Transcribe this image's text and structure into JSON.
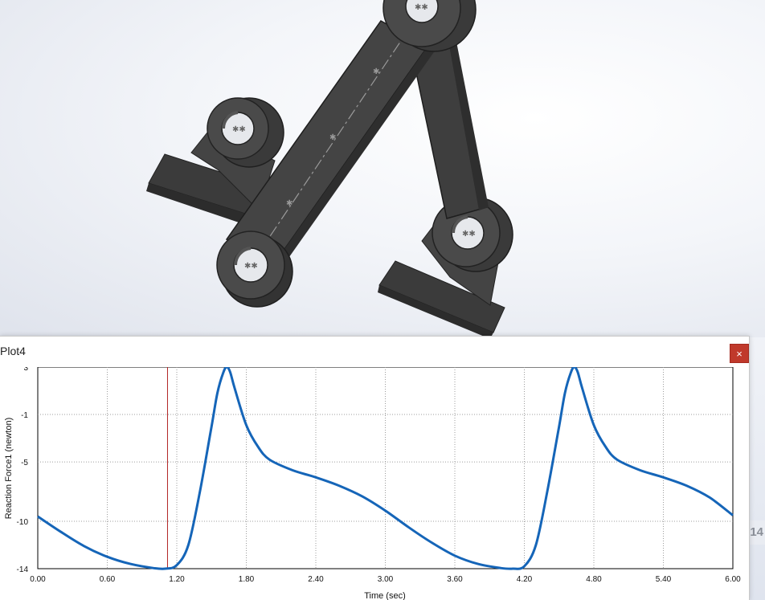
{
  "window": {
    "title": "Plot4",
    "close_label": "×"
  },
  "side_badge": "14",
  "chart_data": {
    "type": "line",
    "xlabel": "Time (sec)",
    "ylabel": "Reaction Force1 (newton)",
    "xlim": [
      0,
      6
    ],
    "ylim": [
      -14,
      3
    ],
    "x_ticks": [
      "0.00",
      "0.60",
      "1.20",
      "1.80",
      "2.40",
      "3.00",
      "3.60",
      "4.20",
      "4.80",
      "5.40",
      "6.00"
    ],
    "y_ticks": [
      "3",
      "-1",
      "-5",
      "-10",
      "-14"
    ],
    "y_tick_values": [
      3,
      -1,
      -5,
      -10,
      -14
    ],
    "grid": true,
    "cursor_time": 1.12,
    "line_color": "#1565b8",
    "cursor_color": "#b22222",
    "series": [
      {
        "x": [
          0.0,
          0.2,
          0.4,
          0.6,
          0.8,
          1.0,
          1.1,
          1.2,
          1.3,
          1.4,
          1.5,
          1.55,
          1.6,
          1.63,
          1.66,
          1.7,
          1.8,
          1.9,
          2.0,
          2.2,
          2.4,
          2.6,
          2.8,
          3.0,
          3.2,
          3.4,
          3.6,
          3.8,
          4.0,
          4.1,
          4.2,
          4.3,
          4.4,
          4.5,
          4.55,
          4.6,
          4.63,
          4.66,
          4.7,
          4.8,
          4.9,
          5.0,
          5.2,
          5.4,
          5.6,
          5.8,
          6.0
        ],
        "values": [
          -9.6,
          -10.9,
          -12.1,
          -13.0,
          -13.6,
          -13.95,
          -14.0,
          -13.7,
          -12.0,
          -7.5,
          -2.0,
          0.8,
          2.5,
          3.0,
          2.6,
          1.2,
          -1.9,
          -3.7,
          -4.8,
          -5.7,
          -6.3,
          -7.0,
          -7.9,
          -9.1,
          -10.5,
          -11.8,
          -12.9,
          -13.6,
          -13.95,
          -14.0,
          -13.8,
          -12.0,
          -7.4,
          -2.0,
          0.8,
          2.5,
          3.0,
          2.6,
          1.2,
          -1.9,
          -3.7,
          -4.8,
          -5.7,
          -6.3,
          -7.0,
          -8.0,
          -9.5
        ]
      }
    ]
  }
}
